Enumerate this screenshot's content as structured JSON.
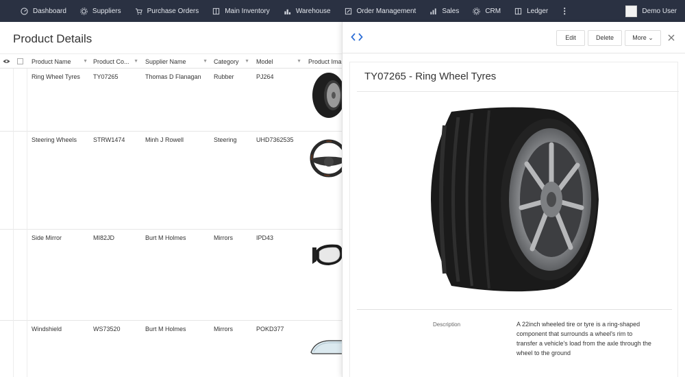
{
  "nav": {
    "items": [
      {
        "label": "Dashboard",
        "icon": "dashboard-icon"
      },
      {
        "label": "Suppliers",
        "icon": "gear-icon"
      },
      {
        "label": "Purchase Orders",
        "icon": "cart-icon"
      },
      {
        "label": "Main Inventory",
        "icon": "book-icon"
      },
      {
        "label": "Warehouse",
        "icon": "warehouse-icon"
      },
      {
        "label": "Order Management",
        "icon": "edit-icon"
      },
      {
        "label": "Sales",
        "icon": "bar-chart-icon"
      },
      {
        "label": "CRM",
        "icon": "gear-icon"
      },
      {
        "label": "Ledger",
        "icon": "book-icon"
      }
    ],
    "more": "⋮",
    "user": "Demo User"
  },
  "page": {
    "title": "Product Details"
  },
  "table": {
    "columns": [
      "Product Name",
      "Product Co...",
      "Supplier Name",
      "Category",
      "Model",
      "Product Ima"
    ],
    "rows": [
      {
        "name": "Ring Wheel Tyres",
        "code": "TY07265",
        "supplier": "Thomas D Flanagan",
        "category": "Rubber",
        "model": "PJ264",
        "image": "tire"
      },
      {
        "name": "Steering Wheels",
        "code": "STRW1474",
        "supplier": "Minh J Rowell",
        "category": "Steering",
        "model": "UHD7362535",
        "image": "steering-wheel"
      },
      {
        "name": "Side Mirror",
        "code": "MI82JD",
        "supplier": "Burt M Holmes",
        "category": "Mirrors",
        "model": "IPD43",
        "image": "side-mirror"
      },
      {
        "name": "Windshield",
        "code": "WS73520",
        "supplier": "Burt M Holmes",
        "category": "Mirrors",
        "model": "POKD377",
        "image": "windshield"
      }
    ]
  },
  "detail": {
    "buttons": {
      "edit": "Edit",
      "delete": "Delete",
      "more": "More ⌄"
    },
    "title": "TY07265 - Ring Wheel Tyres",
    "desc_label": "Description",
    "desc_text": "A 22inch wheeled tire or tyre is a ring-shaped component that surrounds a wheel's rim to transfer a vehicle's load from the axle through the wheel to the ground"
  },
  "colors": {
    "nav_bg": "#2a3142",
    "accent": "#2f6fd6"
  }
}
